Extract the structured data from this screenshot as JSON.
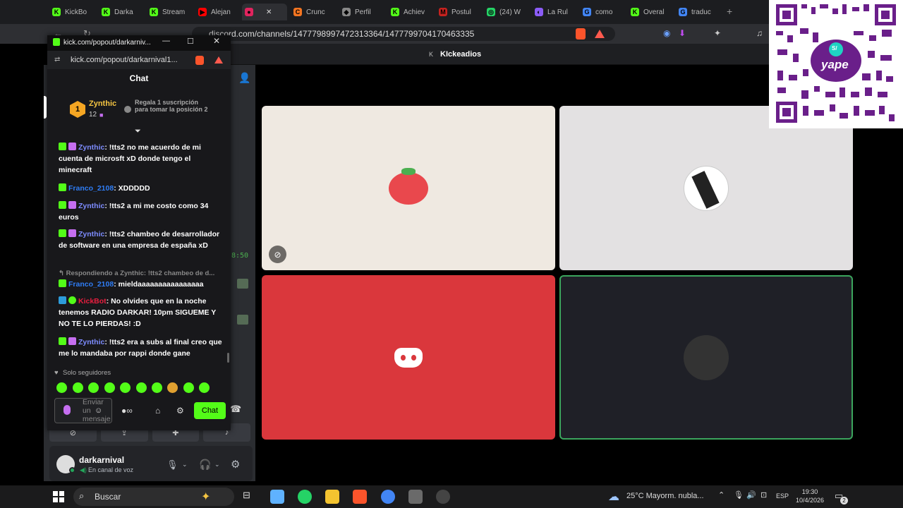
{
  "browser": {
    "tabs": [
      {
        "label": "KickBo",
        "fav": "K",
        "color": "#53fc18"
      },
      {
        "label": "Darka",
        "fav": "K",
        "color": "#53fc18"
      },
      {
        "label": "Stream",
        "fav": "K",
        "color": "#53fc18"
      },
      {
        "label": "Alejan",
        "fav": "▶",
        "color": "#ff0000"
      },
      {
        "label": "",
        "fav": "●",
        "color": "#e0245e"
      },
      {
        "label": "Crunc",
        "fav": "C",
        "color": "#f47521"
      },
      {
        "label": "Perfil",
        "fav": "◆",
        "color": "#888888"
      },
      {
        "label": "Achiev",
        "fav": "K",
        "color": "#53fc18"
      },
      {
        "label": "Postul",
        "fav": "M",
        "color": "#c5221f"
      },
      {
        "label": "(24) W",
        "fav": "◎",
        "color": "#25d366"
      },
      {
        "label": "La Rul",
        "fav": "◐",
        "color": "#8b5cf6"
      },
      {
        "label": "como",
        "fav": "G",
        "color": "#4285f4"
      },
      {
        "label": "Overal",
        "fav": "K",
        "color": "#53fc18"
      },
      {
        "label": "traduc",
        "fav": "G",
        "color": "#4285f4"
      }
    ],
    "url": "discord.com/channels/1477798997472313364/1477799704170463335",
    "new_tab": "+"
  },
  "popup": {
    "title": "kick.com/popout/darkarniv...",
    "url": "kick.com/popout/darkarnival1...",
    "header": "Chat",
    "leader": {
      "rank": "1",
      "name": "Zynthic",
      "count": "12",
      "promo": "Regala 1 suscripción para tomar la posición 2"
    },
    "messages": [
      {
        "user": "Zynthic",
        "color": "#7d8cff",
        "text": ": !tts2 no me acuerdo de mi cuenta de microsft xD donde tengo el minecraft"
      },
      {
        "user": "Franco_2108",
        "color": "#2f7df6",
        "text": ": XDDDDD"
      },
      {
        "user": "Zynthic",
        "color": "#7d8cff",
        "text": ": !tts2 a mi me costo como 34 euros"
      },
      {
        "user": "Zynthic",
        "color": "#7d8cff",
        "text": ": !tts2 chambeo de desarrollador de software en una empresa de españa xD"
      },
      {
        "user": "Franco_2108",
        "color": "#2f7df6",
        "text": ": mieldaaaaaaaaaaaaaaaa"
      },
      {
        "user": "KickBot",
        "color": "#e91e3f",
        "text": ": No olvides que en la noche tenemos RADIO DARKAR! 10pm SIGUEME Y NO TE LO PIERDAS! :D"
      },
      {
        "user": "Zynthic",
        "color": "#7d8cff",
        "text": ": !tts2 era a subs al final creo que me lo mandaba por rappi donde gane"
      }
    ],
    "reply_note": "Respondiendo a Zynthic: !tts2 chambeo de d...",
    "followers_only": "Solo seguidores",
    "input_placeholder": "Enviar un mensaje",
    "chat_button": "Chat"
  },
  "discord": {
    "channel": "KIckeadios",
    "timestamp": "8:50",
    "user": {
      "name": "darkarnival",
      "status": "En canal de voz"
    }
  },
  "taskbar": {
    "search": "Buscar",
    "weather": "25°C  Mayorm. nubla...",
    "lang": "ESP",
    "time": "19:30",
    "date": "10/4/2026",
    "notif_count": "2"
  },
  "qr": {
    "brand": "yape",
    "badge": "S/"
  },
  "colors": {
    "kick_green": "#53fc18",
    "discord_red": "#da373c",
    "discord_bg": "#2b2d31"
  }
}
